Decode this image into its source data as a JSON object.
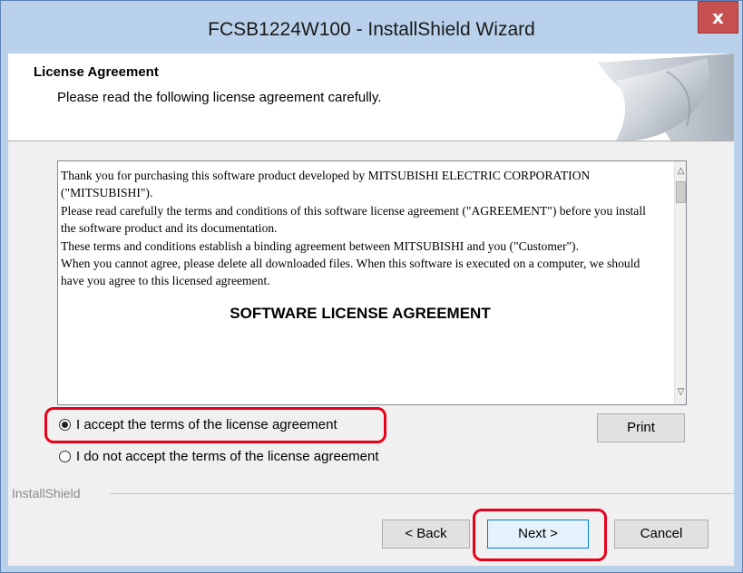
{
  "window": {
    "title": "FCSB1224W100 - InstallShield Wizard",
    "close_label": "x"
  },
  "header": {
    "title": "License Agreement",
    "subtitle": "Please read the following license agreement carefully."
  },
  "license": {
    "paragraph1": "Thank you for purchasing this software product developed by MITSUBISHI ELECTRIC CORPORATION (\"MITSUBISHI\").",
    "paragraph2": "Please read carefully the terms and conditions of this software license agreement (\"AGREEMENT\") before you install the software product and its documentation.",
    "paragraph3": "These terms and conditions establish a binding agreement between MITSUBISHI and you (\"Customer\").",
    "paragraph4": "When you cannot agree, please delete all downloaded files. When this software is executed on a computer, we should have you agree to this licensed agreement.",
    "heading": "SOFTWARE LICENSE AGREEMENT",
    "scroll_up_icon": "chevron-up-icon",
    "scroll_down_icon": "chevron-down-icon"
  },
  "options": {
    "accept_label": "I accept the terms of the license agreement",
    "decline_label": "I do not accept the terms of the license agreement",
    "selected": "accept"
  },
  "buttons": {
    "print": "Print",
    "back": "< Back",
    "next": "Next >",
    "cancel": "Cancel"
  },
  "footer": {
    "brand": "InstallShield"
  },
  "colors": {
    "highlight": "#e8001c",
    "titlebar": "#b9d1ea",
    "close": "#c75050"
  }
}
